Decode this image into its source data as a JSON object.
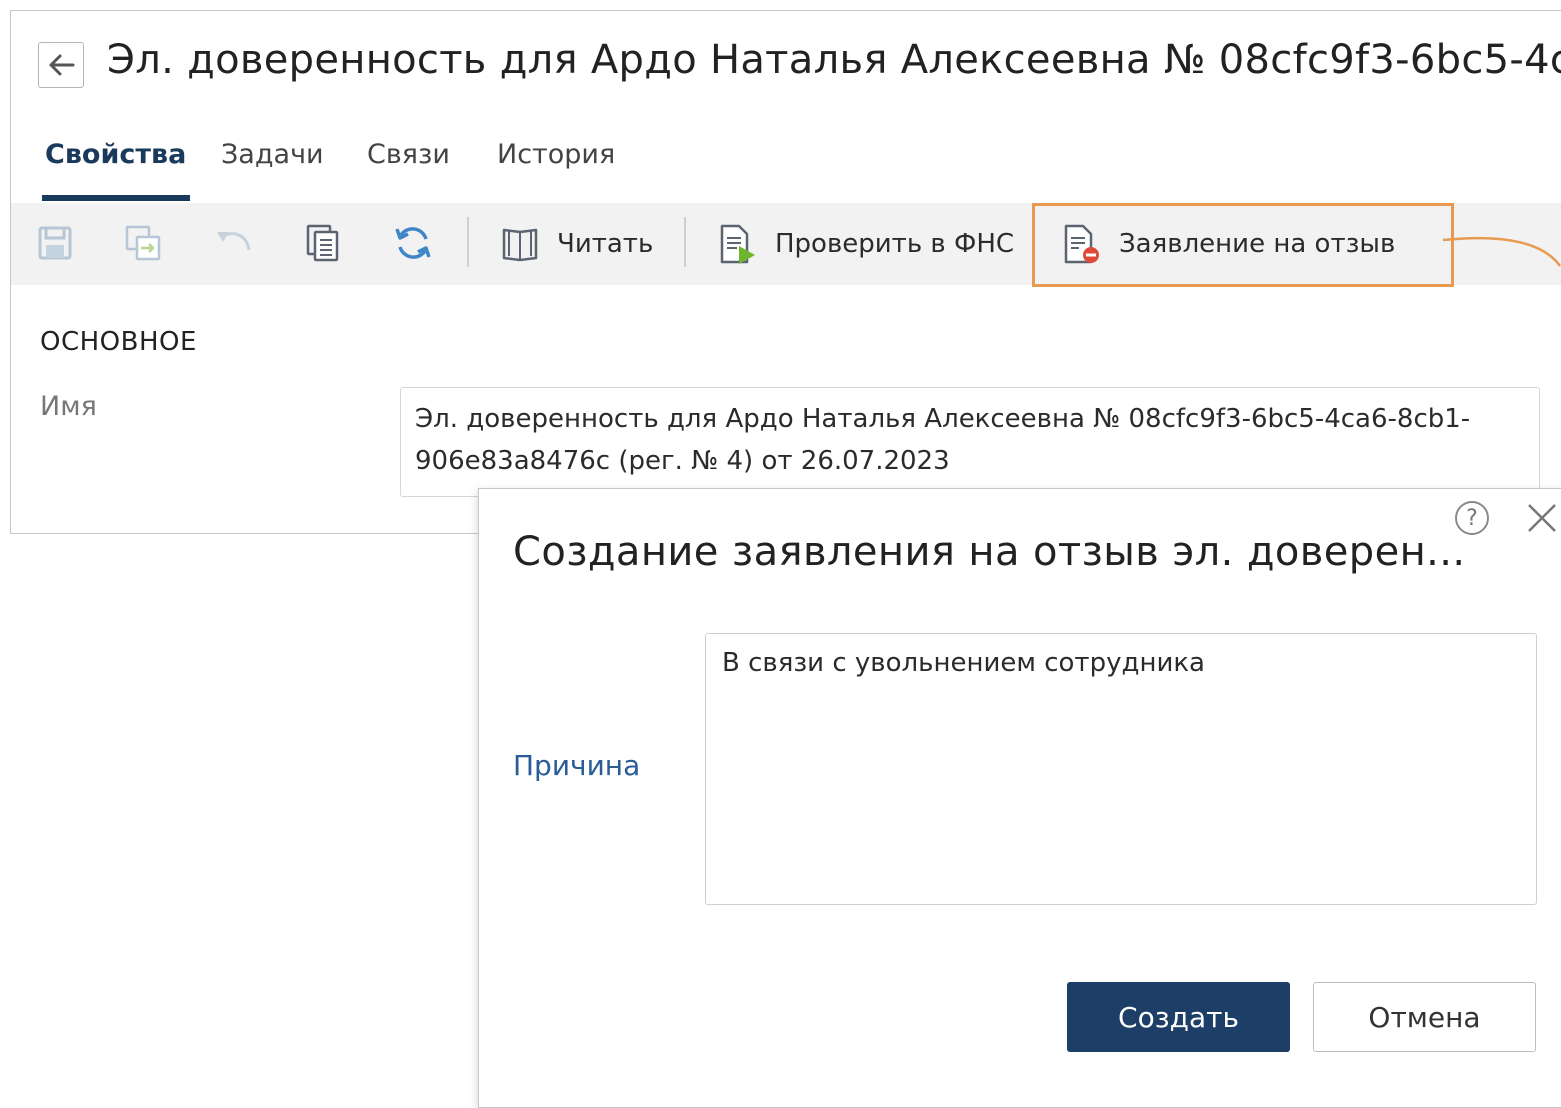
{
  "header": {
    "title": "Эл. доверенность для Ардо Наталья Алексеевна № 08cfc9f3-6bc5-4ca"
  },
  "tabs": [
    {
      "label": "Свойства",
      "active": true
    },
    {
      "label": "Задачи"
    },
    {
      "label": "Связи"
    },
    {
      "label": "История"
    }
  ],
  "toolbar": {
    "read_label": "Читать",
    "check_fns_label": "Проверить в ФНС",
    "revoke_label": "Заявление на отзыв",
    "highlight_color": "#e79a50"
  },
  "form": {
    "section_title": "ОСНОВНОЕ",
    "name_label": "Имя",
    "name_value": "Эл. доверенность для Ардо Наталья Алексеевна № 08cfc9f3-6bc5-4ca6-8cb1-906e83a8476c (рег. № 4) от 26.07.2023"
  },
  "dialog": {
    "title": "Создание заявления на отзыв эл. доверен...",
    "help_symbol": "?",
    "reason_label": "Причина",
    "reason_value": "В связи с увольнением сотрудника",
    "create_label": "Создать",
    "cancel_label": "Отмена",
    "primary_color": "#1d3e66"
  }
}
